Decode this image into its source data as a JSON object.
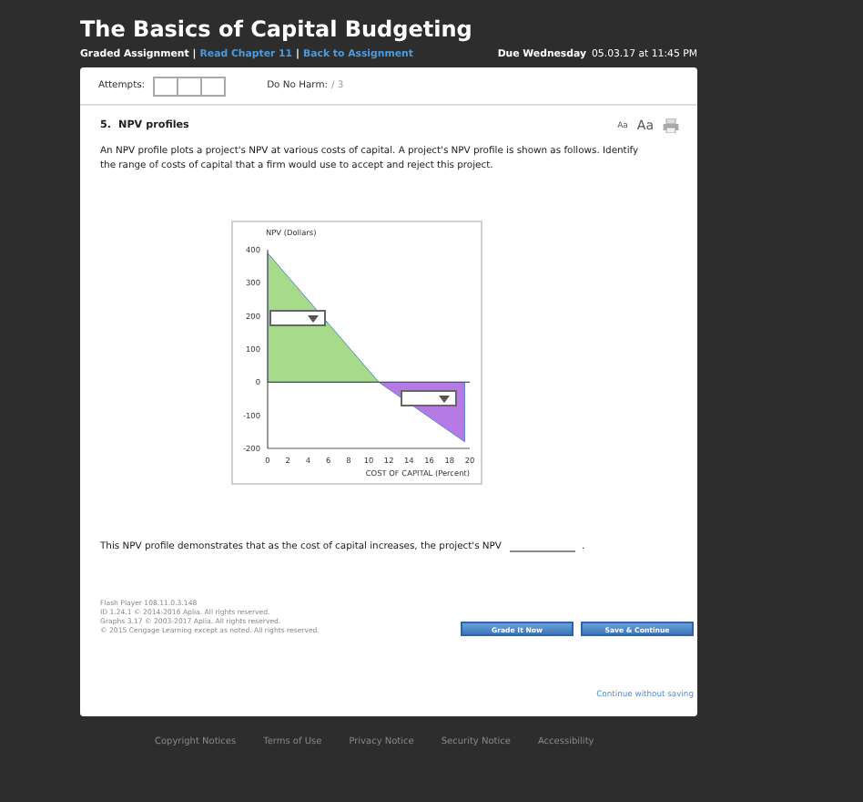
{
  "header": {
    "title": "The Basics of Capital Budgeting",
    "separator": "|",
    "links": [
      {
        "text": "Graded Assignment",
        "kind": "label"
      },
      {
        "text": "Read Chapter 11",
        "kind": "link"
      },
      {
        "text": "Back to Assignment",
        "kind": "link"
      }
    ],
    "due_label": "Due Wednesday",
    "due_date": "05.03.17 at 11:45 PM"
  },
  "attempts": {
    "label": "Attempts:",
    "boxes": [
      {
        "filled": false
      },
      {
        "filled": false
      },
      {
        "filled": false
      }
    ]
  },
  "score": {
    "label": "Do No Harm:",
    "value": "/ 3"
  },
  "question": {
    "number": "5.",
    "title": "NPV profiles",
    "text_size_buttons": [
      {
        "text": "Aa",
        "kind": "small"
      },
      {
        "text": "Aa",
        "kind": "large"
      }
    ],
    "prompt": "An NPV profile plots a project's NPV at various costs of capital. A project's NPV profile is shown as follows. Identify the range of costs of capital that a firm would use to accept and reject this project.",
    "chart_data": {
      "type": "area",
      "xlabel": "COST OF CAPITAL (Percent)",
      "ylabel": "NPV (Dollars)",
      "x": [
        0,
        11,
        19.5
      ],
      "series": [
        {
          "color": "#a6db8a",
          "values": [
            390,
            0,
            null
          ]
        },
        {
          "color": "#b57ae3",
          "values": [
            null,
            0,
            -180
          ]
        }
      ],
      "xlim": [
        0,
        20
      ],
      "ylim": [
        -200,
        400
      ],
      "xticks": [
        0,
        2,
        4,
        6,
        8,
        10,
        12,
        14,
        16,
        18,
        20
      ],
      "yticks": [
        -200,
        -100,
        0,
        100,
        200,
        300,
        400
      ]
    },
    "dropdowns": [
      {
        "expanded": false
      },
      {
        "expanded": false
      }
    ],
    "sentence": "This NPV profile demonstrates that as the cost of capital increases, the project's NPV",
    "sentence_end": "."
  },
  "credits": [
    "Flash Player 108.11.0.3.148",
    "ID 1.24.1 © 2014-2016 Aplia. All rights reserved.",
    "Graphs 3.17 © 2003-2017 Aplia. All rights reserved.",
    "© 2015 Cengage Learning except as noted. All rights reserved."
  ],
  "buttons": [
    "Grade It Now",
    "Save & Continue"
  ],
  "continue_link": "Continue without saving",
  "footer_links": [
    "Copyright Notices",
    "Terms of Use",
    "Privacy Notice",
    "Security Notice",
    "Accessibility"
  ]
}
